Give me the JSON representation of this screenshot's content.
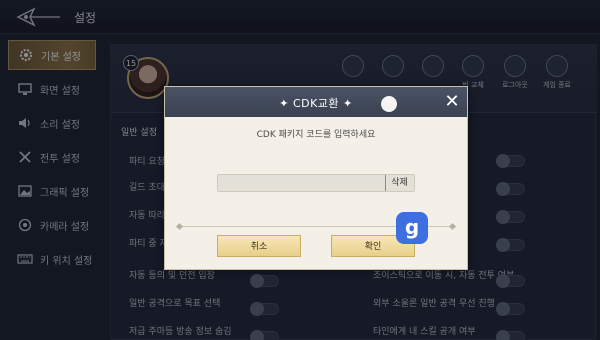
{
  "topbar": {
    "title": "설정"
  },
  "sidebar": {
    "items": [
      {
        "label": "기본 설정",
        "icon": "gear-icon"
      },
      {
        "label": "화면 설정",
        "icon": "monitor-icon"
      },
      {
        "label": "소리 설정",
        "icon": "speaker-icon"
      },
      {
        "label": "전투 설정",
        "icon": "battle-icon"
      },
      {
        "label": "그래픽 설정",
        "icon": "image-icon"
      },
      {
        "label": "카메라 설정",
        "icon": "camera-icon"
      },
      {
        "label": "키 위치 설정",
        "icon": "keyboard-icon"
      }
    ]
  },
  "profile": {
    "level": "15",
    "menu": [
      {
        "label": ""
      },
      {
        "label": ""
      },
      {
        "label": ""
      },
      {
        "label": "번 교체"
      },
      {
        "label": "로그아웃"
      },
      {
        "label": "게임 종료"
      }
    ]
  },
  "settings": {
    "section_title": "일반 설정",
    "left_rows": [
      "파티 요청",
      "길드 초대",
      "자동 따라",
      "파티 중 자",
      "자동 등의 및 던전 입장",
      "일반 공격으로 목표 선택",
      "저급 주마등 방송 정보 숨김"
    ],
    "right_rows": [
      "",
      "",
      "",
      "",
      "조이스틱으로 이동 시, 자동 전투 여부",
      "외부 소울론 일반 공격 우선 진행",
      "타인에게 내 스킬 공개 여부"
    ]
  },
  "modal": {
    "title": "CDK교환",
    "prompt": "CDK 패키지 코드를 입력하세요",
    "input_value": "",
    "delete_label": "삭제",
    "cancel_label": "취소",
    "confirm_label": "확인"
  },
  "overlay_badge": "g",
  "colors": {
    "accent_gold": "#e8cf8a",
    "panel_bg": "#1f2637",
    "modal_bg": "#f4f0e7"
  }
}
